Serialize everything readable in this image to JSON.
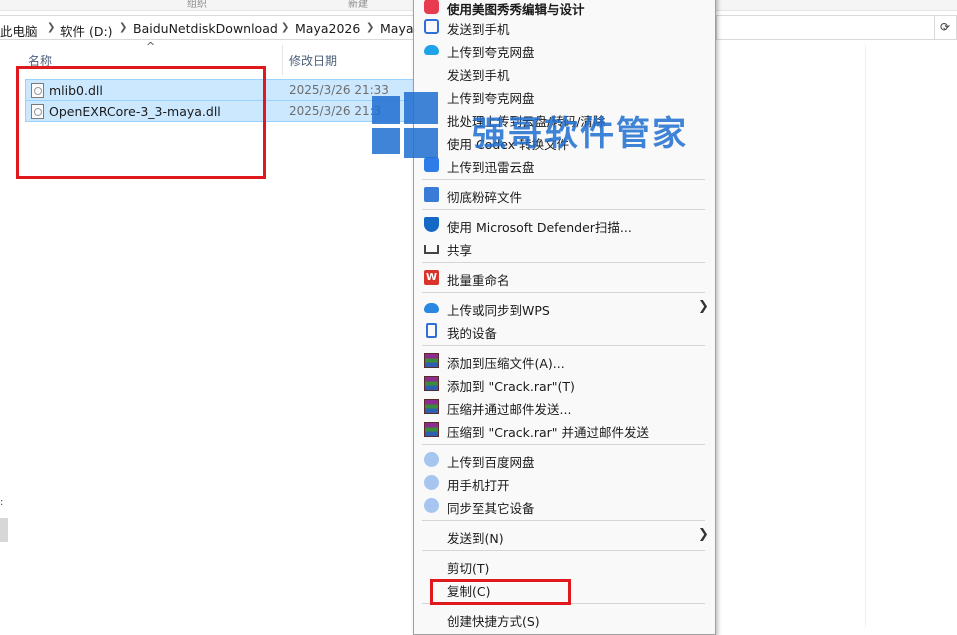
{
  "ribbon": {
    "group_left": "组织",
    "group_right": "新建"
  },
  "breadcrumb": [
    "此电脑",
    "软件 (D:)",
    "BaiduNetdiskDownload",
    "Maya2026",
    "Maya"
  ],
  "columns": {
    "name": "名称",
    "modified": "修改日期"
  },
  "files": [
    {
      "name": "mlib0.dll",
      "date": "2025/3/26 21:33"
    },
    {
      "name": "OpenEXRCore-3_3-maya.dll",
      "date": "2025/3/26 21:3"
    }
  ],
  "context_menu": {
    "items": [
      {
        "label": "使用美图秀秀编辑与设计",
        "icon": "meitu-icon"
      },
      {
        "label": "发送到手机",
        "icon": "phone-send-icon"
      },
      {
        "label": "上传到夸克网盘",
        "icon": "quark-cloud-icon"
      },
      {
        "label": "发送到手机",
        "icon": ""
      },
      {
        "label": "上传到夸克网盘",
        "icon": ""
      },
      {
        "label": "批处理上传到云盘/转码/清除",
        "icon": ""
      },
      {
        "label": "使用 Codex 转换文件",
        "icon": ""
      },
      {
        "label": "上传到迅雷云盘",
        "icon": "xunlei-icon"
      },
      {
        "label": "彻底粉碎文件",
        "icon": "shredder-icon"
      },
      {
        "label": "使用 Microsoft Defender扫描...",
        "icon": "defender-shield-icon"
      },
      {
        "label": "共享",
        "icon": "share-icon"
      },
      {
        "label": "批量重命名",
        "icon": "wps-rename-icon"
      },
      {
        "label": "上传或同步到WPS",
        "icon": "wps-cloud-icon",
        "submenu": true
      },
      {
        "label": "我的设备",
        "icon": "device-icon"
      },
      {
        "label": "添加到压缩文件(A)...",
        "icon": "winrar-icon"
      },
      {
        "label": "添加到 \"Crack.rar\"(T)",
        "icon": "winrar-icon"
      },
      {
        "label": "压缩并通过邮件发送...",
        "icon": "winrar-icon"
      },
      {
        "label": "压缩到 \"Crack.rar\" 并通过邮件发送",
        "icon": "winrar-icon"
      },
      {
        "label": "上传到百度网盘",
        "icon": "baidu-cloud-icon"
      },
      {
        "label": "用手机打开",
        "icon": "baidu-cloud-icon"
      },
      {
        "label": "同步至其它设备",
        "icon": "baidu-cloud-icon"
      },
      {
        "label": "发送到(N)",
        "icon": "",
        "submenu": true
      },
      {
        "label": "剪切(T)",
        "icon": ""
      },
      {
        "label": "复制(C)",
        "icon": ""
      },
      {
        "label": "创建快捷方式(S)",
        "icon": ""
      }
    ]
  },
  "watermark": {
    "text": "强哥软件管家"
  },
  "colors": {
    "selection": "#cce8ff",
    "highlight_box": "#e0191f",
    "accent": "#1f6fd1"
  }
}
